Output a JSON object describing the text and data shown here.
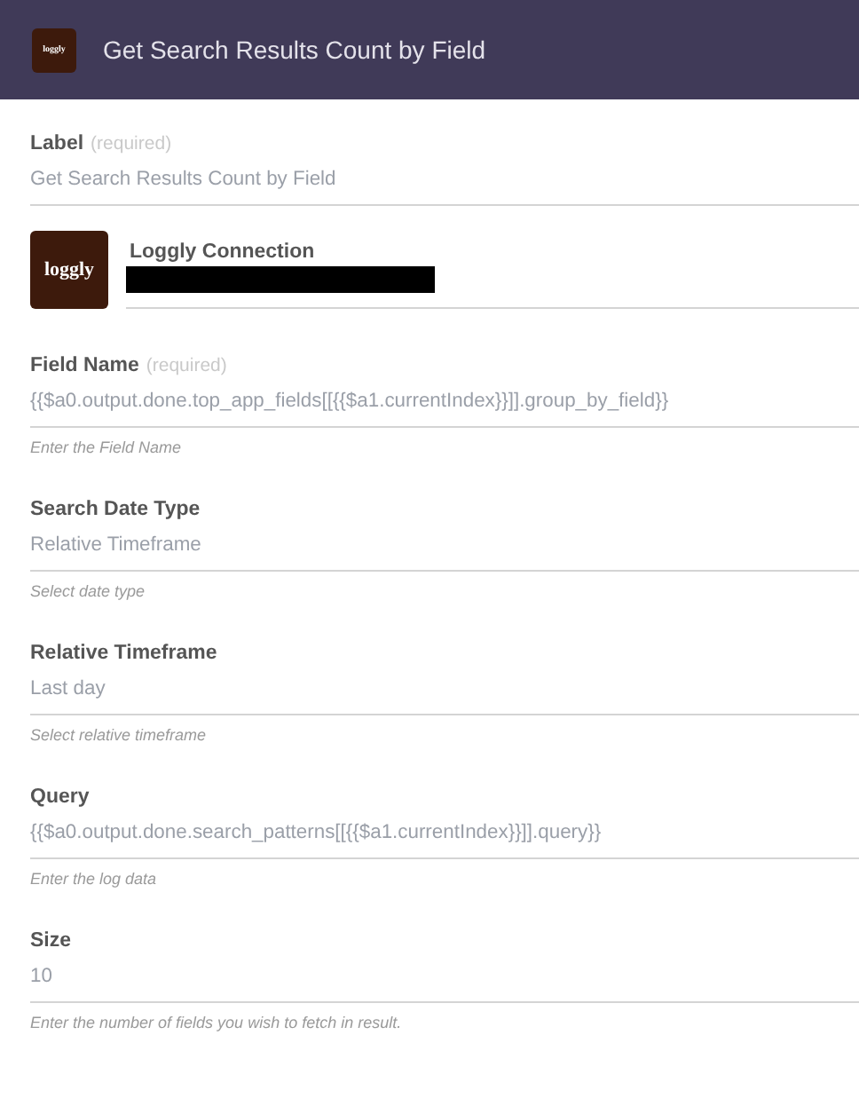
{
  "header": {
    "icon_text": "loggly",
    "title": "Get Search Results Count by Field"
  },
  "label_field": {
    "label": "Label",
    "note": "(required)",
    "value": "Get Search Results Count by Field"
  },
  "connection": {
    "icon_text": "loggly",
    "title": "Loggly Connection",
    "redacted": true
  },
  "fields": [
    {
      "label": "Field Name",
      "note": "(required)",
      "value": "{{$a0.output.done.top_app_fields[[{{$a1.currentIndex}}]].group_by_field}}",
      "help": "Enter the Field Name"
    },
    {
      "label": "Search Date Type",
      "value": "Relative Timeframe",
      "help": "Select date type"
    },
    {
      "label": "Relative Timeframe",
      "value": "Last day",
      "help": "Select relative timeframe"
    },
    {
      "label": "Query",
      "value": "{{$a0.output.done.search_patterns[[{{$a1.currentIndex}}]].query}}",
      "help": "Enter the log data"
    },
    {
      "label": "Size",
      "value": "10",
      "help": "Enter the number of fields you wish to fetch in result."
    }
  ]
}
